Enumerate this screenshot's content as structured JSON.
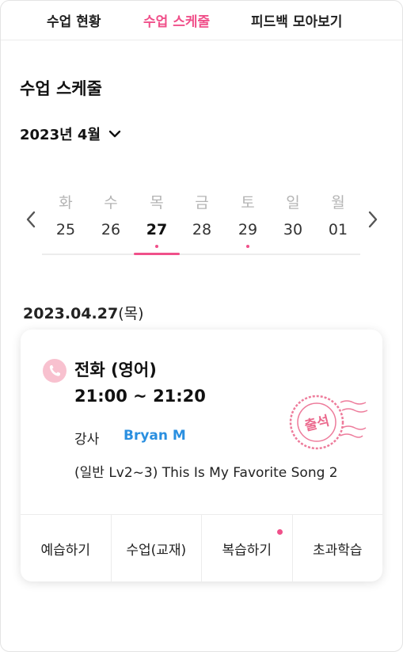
{
  "tabs": [
    {
      "label": "수업 현황",
      "active": false
    },
    {
      "label": "수업 스케줄",
      "active": true
    },
    {
      "label": "피드백 모아보기",
      "active": false
    }
  ],
  "section_title": "수업 스케줄",
  "month_label": "2023년 4월",
  "week": [
    {
      "weekday": "화",
      "date": "25",
      "selected": false,
      "has_dot": false
    },
    {
      "weekday": "수",
      "date": "26",
      "selected": false,
      "has_dot": false
    },
    {
      "weekday": "목",
      "date": "27",
      "selected": true,
      "has_dot": true
    },
    {
      "weekday": "금",
      "date": "28",
      "selected": false,
      "has_dot": false
    },
    {
      "weekday": "토",
      "date": "29",
      "selected": false,
      "has_dot": true
    },
    {
      "weekday": "일",
      "date": "30",
      "selected": false,
      "has_dot": false
    },
    {
      "weekday": "월",
      "date": "01",
      "selected": false,
      "has_dot": false
    }
  ],
  "selected_date": "2023.04.27",
  "selected_weekday": "(목)",
  "lesson_card": {
    "type": "전화 (영어)",
    "time": "21:00 ~ 21:20",
    "teacher_label": "강사",
    "teacher_name": "Bryan M",
    "title": "(일반 Lv2~3) This Is My Favorite Song 2",
    "stamp_text": "출석",
    "actions": [
      {
        "label": "예습하기",
        "has_dot": false
      },
      {
        "label": "수업(교재)",
        "has_dot": false
      },
      {
        "label": "복습하기",
        "has_dot": true
      },
      {
        "label": "초과학습",
        "has_dot": false
      }
    ]
  },
  "colors": {
    "accent": "#f0508a",
    "link": "#2a8fe0",
    "stamp": "#e8507a"
  }
}
